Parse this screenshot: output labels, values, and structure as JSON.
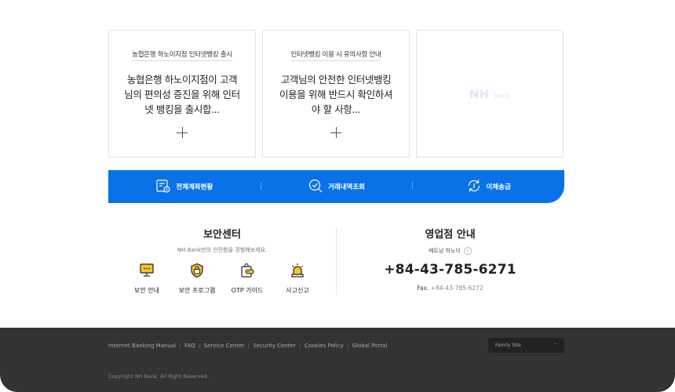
{
  "cards": [
    {
      "tag": "농협은행 하노이지점 인터넷뱅킹 출시",
      "body": "농협은행 하노이지점이 고객님의 편의성 증진을 위해 인터넷 뱅킹을 출시합..."
    },
    {
      "tag": "인터넷뱅킹 이용 시 유의사항 안내",
      "body": "고객님의 안전한 인터넷뱅킹 이용을 위해 반드시 확인하셔야 할 사항..."
    },
    {
      "logo": "NH",
      "logo_sub": "Bank"
    }
  ],
  "quickbar": {
    "color": "#0a72e8",
    "items": [
      {
        "label": "전체계좌현황",
        "icon": "account-icon"
      },
      {
        "label": "거래내역조회",
        "icon": "search-check-icon"
      },
      {
        "label": "이체송금",
        "icon": "transfer-icon"
      }
    ]
  },
  "security": {
    "title": "보안센터",
    "subtitle": "NH Bank만의 안전함을 경험해보세요.",
    "items": [
      {
        "label": "보안 안내",
        "icon": "monitor-icon"
      },
      {
        "label": "보안 프로그램",
        "icon": "lock-icon"
      },
      {
        "label": "OTP 가이드",
        "icon": "otp-icon"
      },
      {
        "label": "사고신고",
        "icon": "siren-icon"
      }
    ]
  },
  "branch": {
    "title": "영업점 안내",
    "link": "베트남 하노이",
    "phone": "+84-43-785-6271",
    "fax_label": "Fax.",
    "fax": "+84-43-785-6272"
  },
  "footer": {
    "links": [
      "Internet Banking Manual",
      "FAQ",
      "Service Center",
      "Security Center",
      "Cookies Policy",
      "Global Portal"
    ],
    "family_site": "Family Site",
    "copyright": "Copyright NH Bank. All Right Reserved."
  }
}
